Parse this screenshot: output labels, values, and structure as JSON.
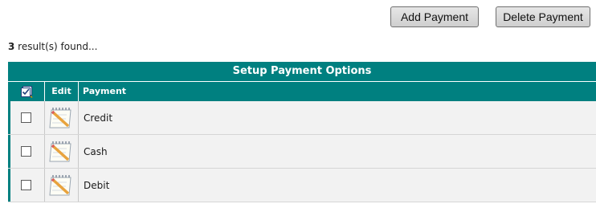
{
  "toolbar": {
    "add_label": "Add Payment",
    "delete_label": "Delete Payment"
  },
  "results": {
    "count": "3",
    "suffix": " result(s) found..."
  },
  "grid": {
    "title": "Setup Payment Options",
    "columns": {
      "select_icon": "checkbox-list-icon",
      "edit": "Edit",
      "payment": "Payment"
    },
    "rows": [
      {
        "payment": "Credit",
        "checked": false,
        "edit_icon": "notepad-pencil-icon"
      },
      {
        "payment": "Cash",
        "checked": false,
        "edit_icon": "notepad-pencil-icon"
      },
      {
        "payment": "Debit",
        "checked": false,
        "edit_icon": "notepad-pencil-icon"
      }
    ]
  },
  "colors": {
    "header_teal": "#008080",
    "row_background": "#f2f2f2"
  }
}
